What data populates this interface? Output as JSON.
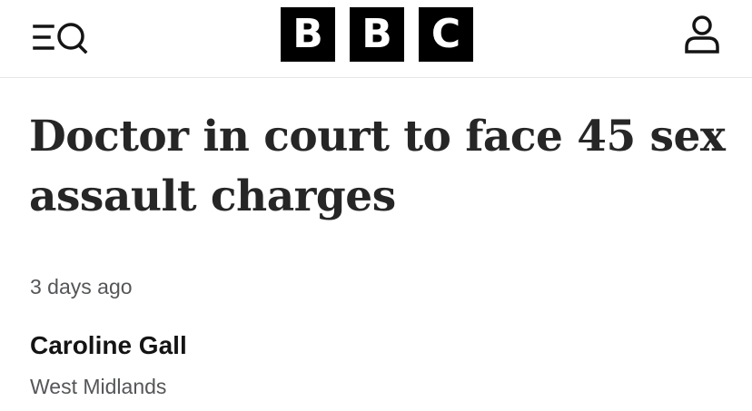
{
  "header": {
    "menu_icon": "menu-search-icon",
    "logo_letters": [
      "B",
      "B",
      "C"
    ],
    "account_icon": "user-account-icon"
  },
  "article": {
    "headline": "Doctor in court to face 45 sex assault charges",
    "timestamp": "3 days ago",
    "author": "Caroline Gall",
    "location": "West Midlands"
  }
}
